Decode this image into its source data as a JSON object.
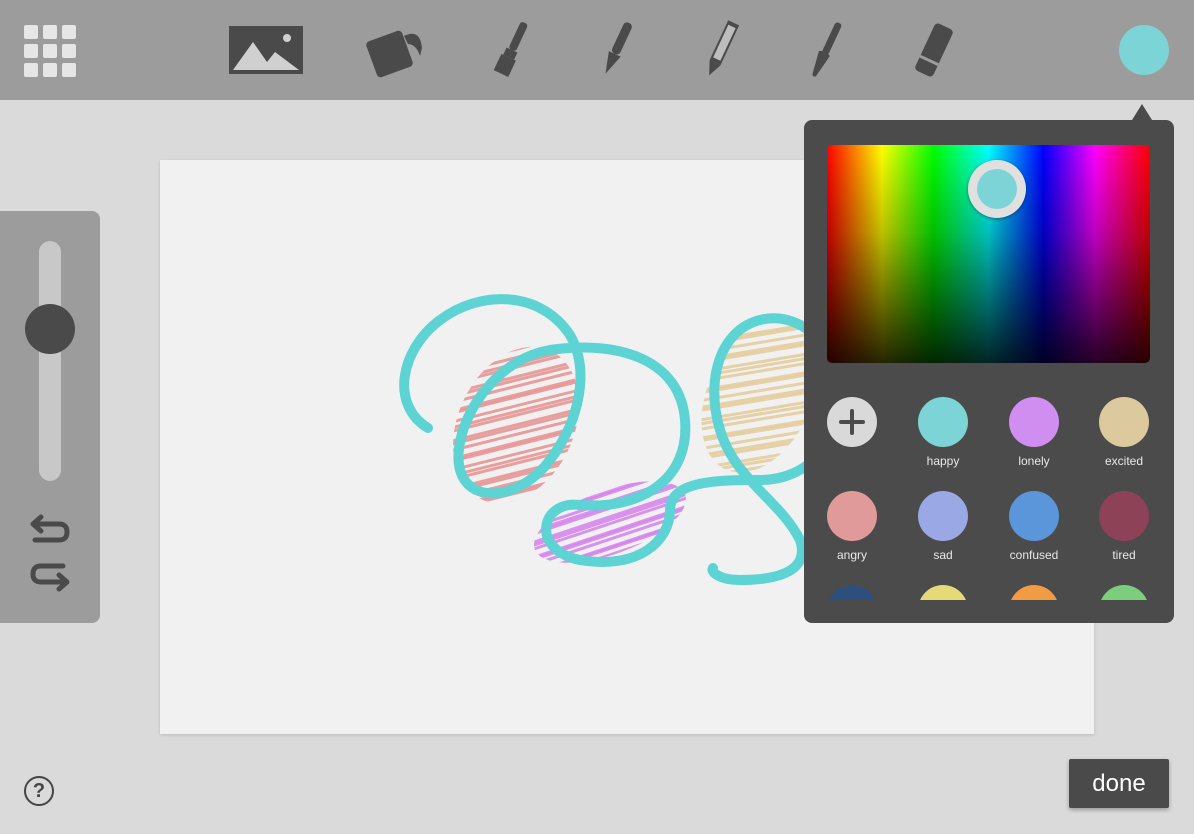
{
  "toolbar": {
    "tools": [
      {
        "name": "image-tool",
        "icon": "image-icon"
      },
      {
        "name": "bucket-tool",
        "icon": "paint-bucket-icon"
      },
      {
        "name": "brush-tool",
        "icon": "flat-brush-icon"
      },
      {
        "name": "pen-tool",
        "icon": "fountain-pen-icon"
      },
      {
        "name": "pencil-tool",
        "icon": "pencil-icon"
      },
      {
        "name": "round-brush-tool",
        "icon": "round-brush-icon"
      },
      {
        "name": "eraser-tool",
        "icon": "eraser-icon"
      }
    ],
    "current_color": "#7dd4d6"
  },
  "size_slider": {
    "value_fraction": 0.33
  },
  "picker": {
    "selected_color": "#7dd4d6",
    "swatches": [
      {
        "label": "happy",
        "color": "#7dd4d6"
      },
      {
        "label": "lonely",
        "color": "#d08ef0"
      },
      {
        "label": "excited",
        "color": "#ddc99e"
      },
      {
        "label": "angry",
        "color": "#e09a9a"
      },
      {
        "label": "sad",
        "color": "#9aa8e6"
      },
      {
        "label": "confused",
        "color": "#5c96da"
      },
      {
        "label": "tired",
        "color": "#8e4258"
      },
      {
        "label": "",
        "color": "#2c4f7e"
      },
      {
        "label": "",
        "color": "#e5d978"
      },
      {
        "label": "",
        "color": "#f29b45"
      },
      {
        "label": "",
        "color": "#7ccd7c"
      }
    ]
  },
  "done_label": "done",
  "help_label": "?",
  "stroke_colors": {
    "main": "#5dd3d3",
    "fill_red": "#e89090",
    "fill_purple": "#d580ee",
    "fill_tan": "#e3cc98"
  }
}
